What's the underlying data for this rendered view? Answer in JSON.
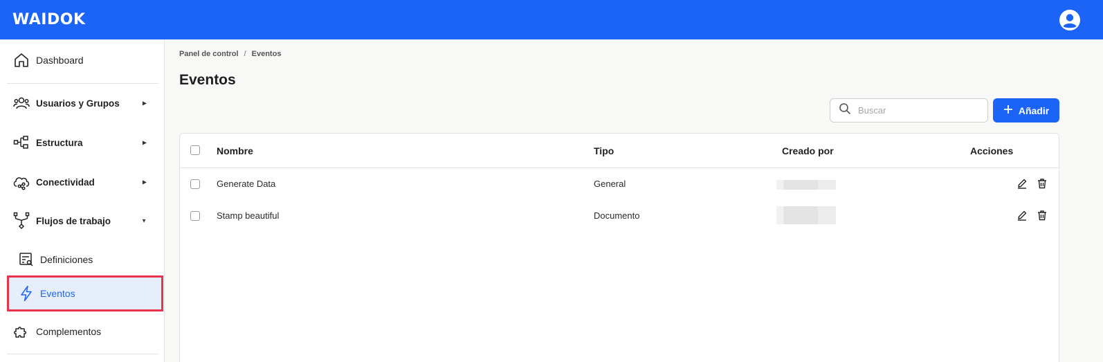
{
  "header": {
    "logo": "WAIDOK",
    "brand_color": "#1c64f8"
  },
  "sidebar": {
    "items": [
      {
        "label": "Dashboard",
        "icon": "home-icon"
      },
      {
        "label": "Usuarios y Grupos",
        "icon": "users-icon"
      },
      {
        "label": "Estructura",
        "icon": "structure-icon"
      },
      {
        "label": "Conectividad",
        "icon": "cloud-share-icon"
      },
      {
        "label": "Flujos de trabajo",
        "icon": "workflow-icon"
      },
      {
        "label": "Complementos",
        "icon": "puzzle-icon"
      }
    ],
    "subitems": [
      {
        "label": "Definiciones",
        "icon": "definitions-icon"
      },
      {
        "label": "Eventos",
        "icon": "bolt-icon",
        "active": true
      }
    ]
  },
  "breadcrumb": {
    "items": [
      "Panel de control",
      "Eventos"
    ]
  },
  "page": {
    "title": "Eventos"
  },
  "search": {
    "placeholder": "Buscar"
  },
  "add_button": {
    "label": "Añadir"
  },
  "table": {
    "columns": [
      "Nombre",
      "Tipo",
      "Creado por",
      "Acciones"
    ],
    "rows": [
      {
        "nombre": "Generate Data",
        "tipo": "General"
      },
      {
        "nombre": "Stamp beautiful",
        "tipo": "Documento"
      }
    ]
  }
}
